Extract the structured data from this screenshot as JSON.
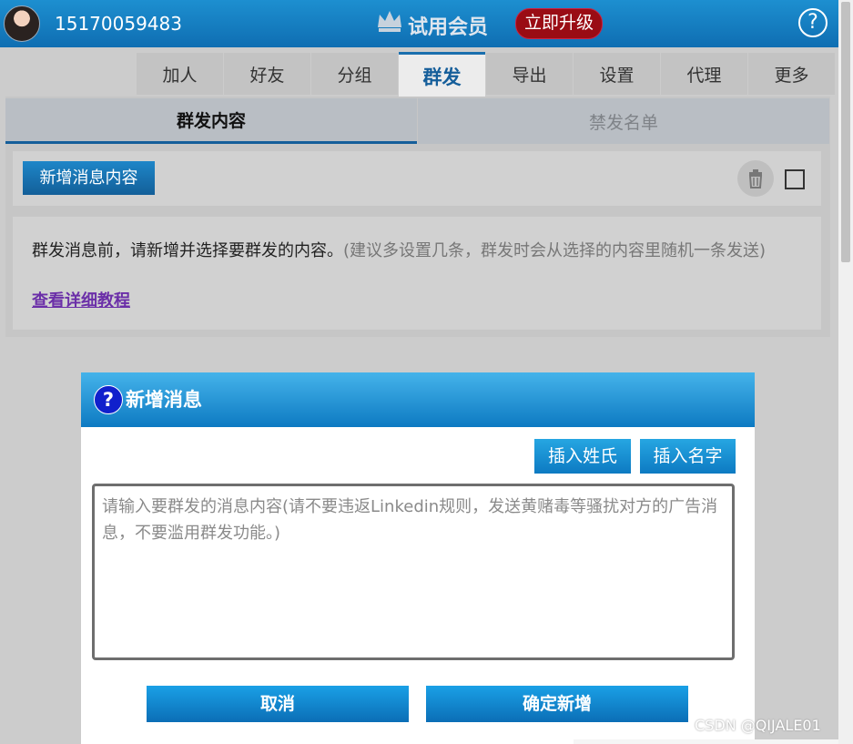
{
  "header": {
    "phone": "15170059483",
    "membership": "试用会员",
    "upgrade_label": "立即升级",
    "help_symbol": "?",
    "icons": {
      "crown": "crown-icon",
      "help": "help-circle-icon",
      "avatar": "user-avatar"
    }
  },
  "tabs": [
    {
      "label": "加人",
      "active": false
    },
    {
      "label": "好友",
      "active": false
    },
    {
      "label": "分组",
      "active": false
    },
    {
      "label": "群发",
      "active": true
    },
    {
      "label": "导出",
      "active": false
    },
    {
      "label": "设置",
      "active": false
    },
    {
      "label": "代理",
      "active": false
    },
    {
      "label": "更多",
      "active": false
    }
  ],
  "subtabs": [
    {
      "label": "群发内容",
      "active": true
    },
    {
      "label": "禁发名单",
      "active": false
    }
  ],
  "toolbar": {
    "add_label": "新增消息内容",
    "icons": {
      "trash": "trash-icon",
      "checkbox": "checkbox-empty"
    }
  },
  "info": {
    "main_text": "群发消息前，请新增并选择要群发的内容。",
    "hint_text": "(建议多设置几条，群发时会从选择的内容里随机一条发送)",
    "tutorial_link": "查看详细教程"
  },
  "modal": {
    "title": "新增消息",
    "insert_surname": "插入姓氏",
    "insert_name": "插入名字",
    "textarea_value": "",
    "textarea_placeholder": "请输入要群发的消息内容(请不要违返Linkedin规则，发送黄赌毒等骚扰对方的广告消息，不要滥用群发功能。)",
    "cancel_label": "取消",
    "confirm_label": "确定新增"
  },
  "watermark": "CSDN @QIJALE01",
  "colors": {
    "brand_blue": "#0f6eb2",
    "upgrade_red": "#9a0c14",
    "link_purple": "#6b2fa8",
    "active_tab_text": "#155e9a"
  }
}
